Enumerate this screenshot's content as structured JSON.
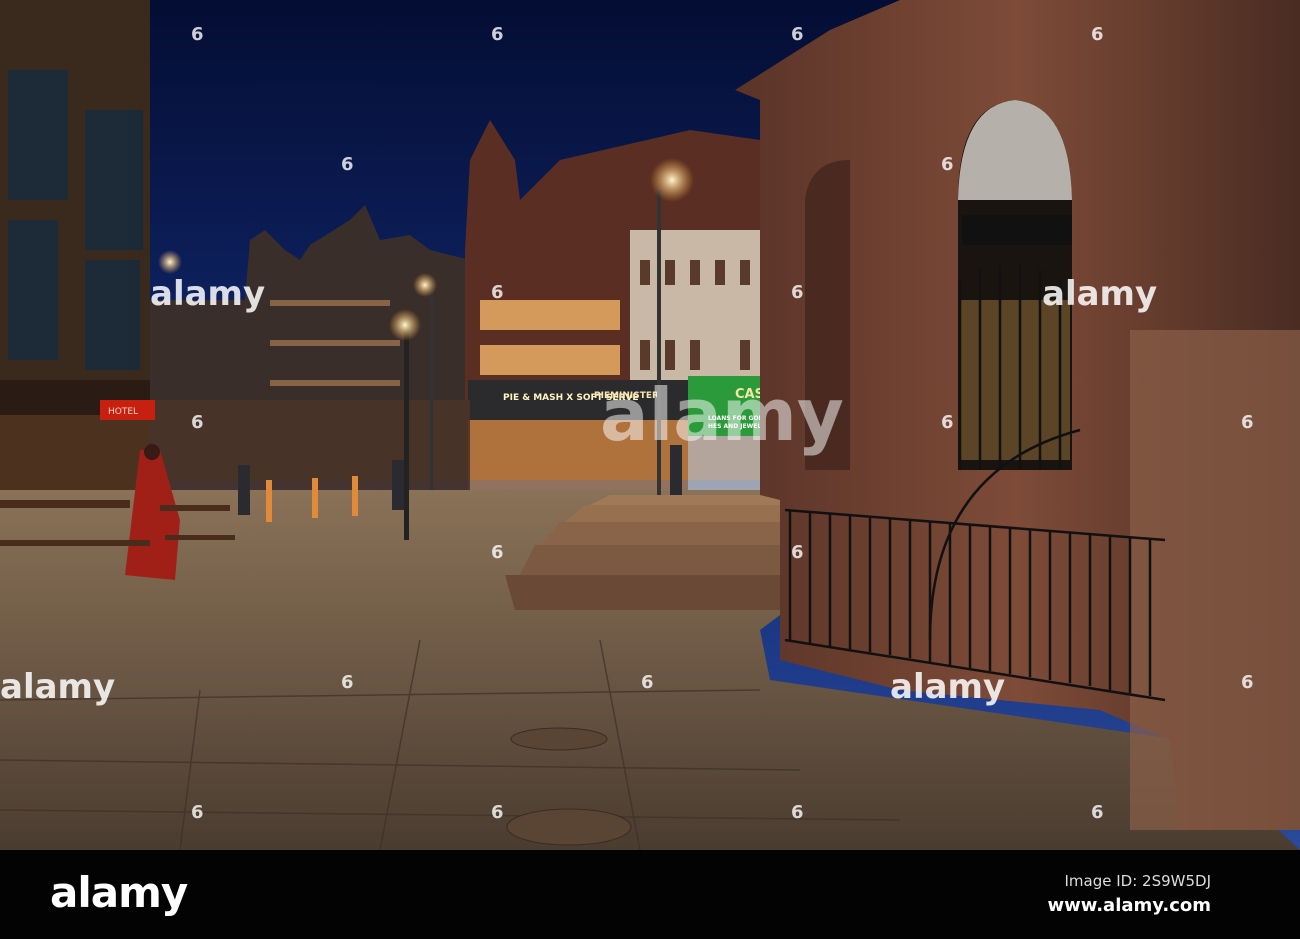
{
  "photo": {
    "subject": "Night street scene with illuminated storefronts and sandstone arched building",
    "signs": {
      "shop_left": "PIE & MASH X SOFT SERVE",
      "shop_name": "PIEMINISTER",
      "cash_sign": "CASH",
      "cash_line1": "LOANS FOR GOLD",
      "cash_line2": "HES AND JEWELLE",
      "red_sign": "HOTEL"
    },
    "colors": {
      "sky_top": "#05103a",
      "sky_bottom": "#1b3b8a",
      "pavement": "#6e5b48",
      "stone": "#7a4a38"
    }
  },
  "watermark": {
    "text": "alamy",
    "number": "6"
  },
  "footer": {
    "logo": "alamy",
    "image_id": "Image ID: 2S9W5DJ",
    "url": "www.alamy.com"
  }
}
